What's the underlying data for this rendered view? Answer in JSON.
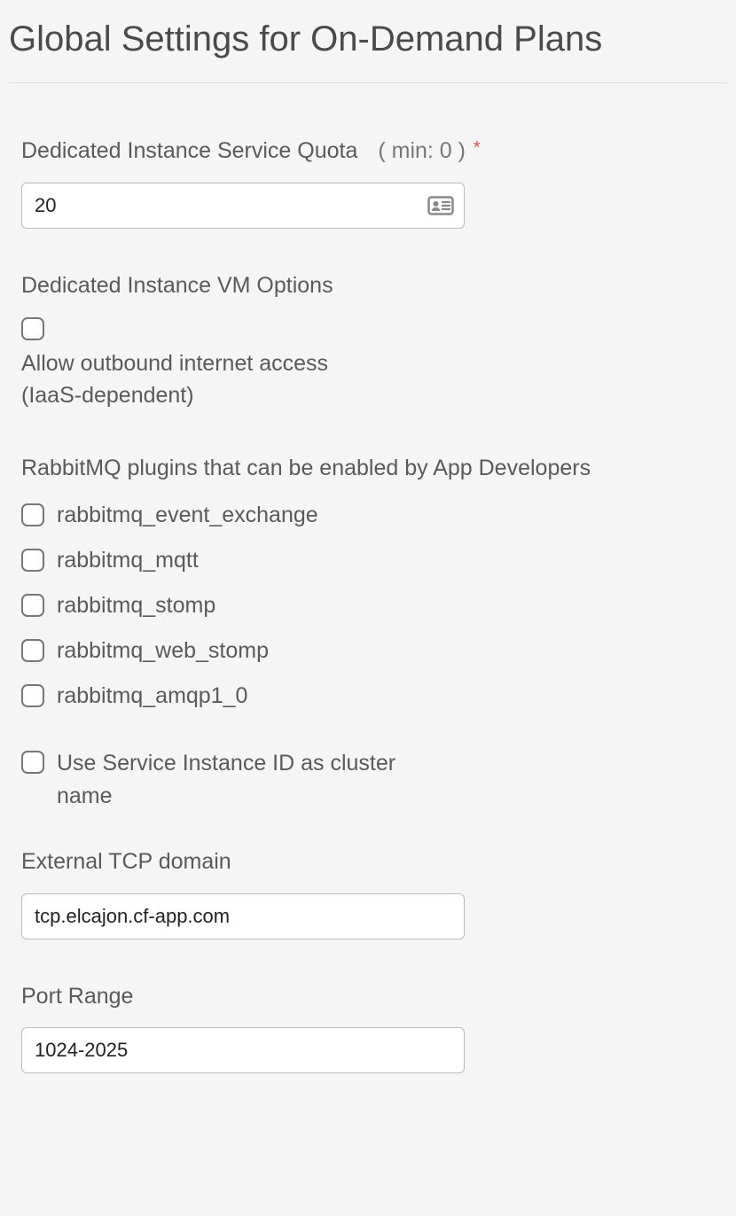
{
  "title": "Global Settings for On-Demand Plans",
  "fields": {
    "quota": {
      "label": "Dedicated Instance Service Quota",
      "hint": "( min: 0 )",
      "required_mark": "*",
      "value": "20"
    },
    "vm_options": {
      "label": "Dedicated Instance VM Options",
      "outbound_label": "Allow outbound internet access (IaaS-dependent)"
    },
    "plugins": {
      "label": "RabbitMQ plugins that can be enabled by App Developers",
      "items": [
        {
          "name": "rabbitmq_event_exchange"
        },
        {
          "name": "rabbitmq_mqtt"
        },
        {
          "name": "rabbitmq_stomp"
        },
        {
          "name": "rabbitmq_web_stomp"
        },
        {
          "name": "rabbitmq_amqp1_0"
        }
      ]
    },
    "cluster_name": {
      "label": "Use Service Instance ID as cluster name"
    },
    "tcp_domain": {
      "label": "External TCP domain",
      "value": "tcp.elcajon.cf-app.com"
    },
    "port_range": {
      "label": "Port Range",
      "value": "1024-2025"
    }
  }
}
